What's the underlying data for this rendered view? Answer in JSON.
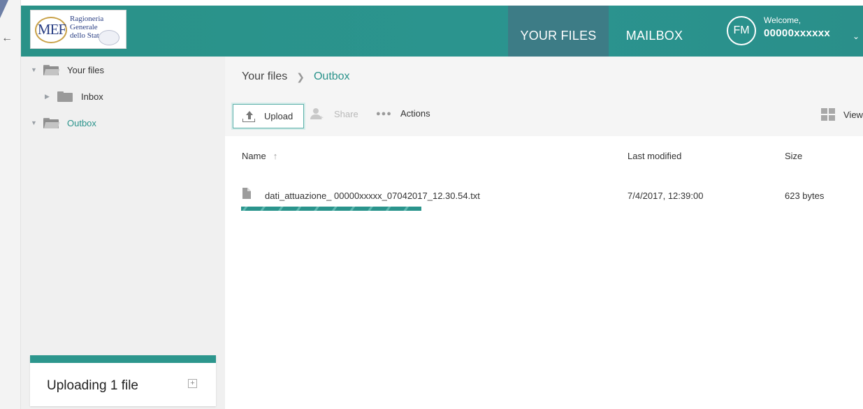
{
  "header": {
    "logo": {
      "mark": "MEF",
      "line1": "Ragioneria",
      "line2": "Generale",
      "line3": "dello Stato"
    },
    "tabs": [
      {
        "label": "YOUR FILES",
        "active": true
      },
      {
        "label": "MAILBOX",
        "active": false
      }
    ],
    "user": {
      "initials": "FM",
      "welcome": "Welcome,",
      "name": "00000xxxxxx"
    }
  },
  "sidebar": {
    "tree": [
      {
        "label": "Your files",
        "expanded": true,
        "selected": false
      },
      {
        "label": "Inbox",
        "expanded": false,
        "selected": false
      },
      {
        "label": "Outbox",
        "expanded": true,
        "selected": true
      }
    ],
    "upload_panel": {
      "title": "Uploading 1 file"
    }
  },
  "main": {
    "breadcrumb": {
      "root": "Your files",
      "current": "Outbox"
    },
    "toolbar": {
      "upload": "Upload",
      "share": "Share",
      "actions": "Actions",
      "view": "View"
    },
    "table": {
      "columns": {
        "name": "Name",
        "modified": "Last modified",
        "size": "Size"
      },
      "rows": [
        {
          "name": "dati_attuazione_ 00000xxxxx_07042017_12.30.54.txt",
          "modified": "7/4/2017, 12:39:00",
          "size": "623 bytes",
          "upload_progress": 1.0
        }
      ]
    }
  },
  "colors": {
    "brand_teal": "#2a9288",
    "active_tab": "#3d7c86",
    "link_teal": "#2a938b"
  },
  "icons": [
    "folder-icon",
    "upload-icon",
    "share-icon",
    "more-dots-icon",
    "grid-view-icon",
    "document-icon",
    "sort-up-icon",
    "expand-icon",
    "chevron-down-icon",
    "back-arrow-icon"
  ]
}
